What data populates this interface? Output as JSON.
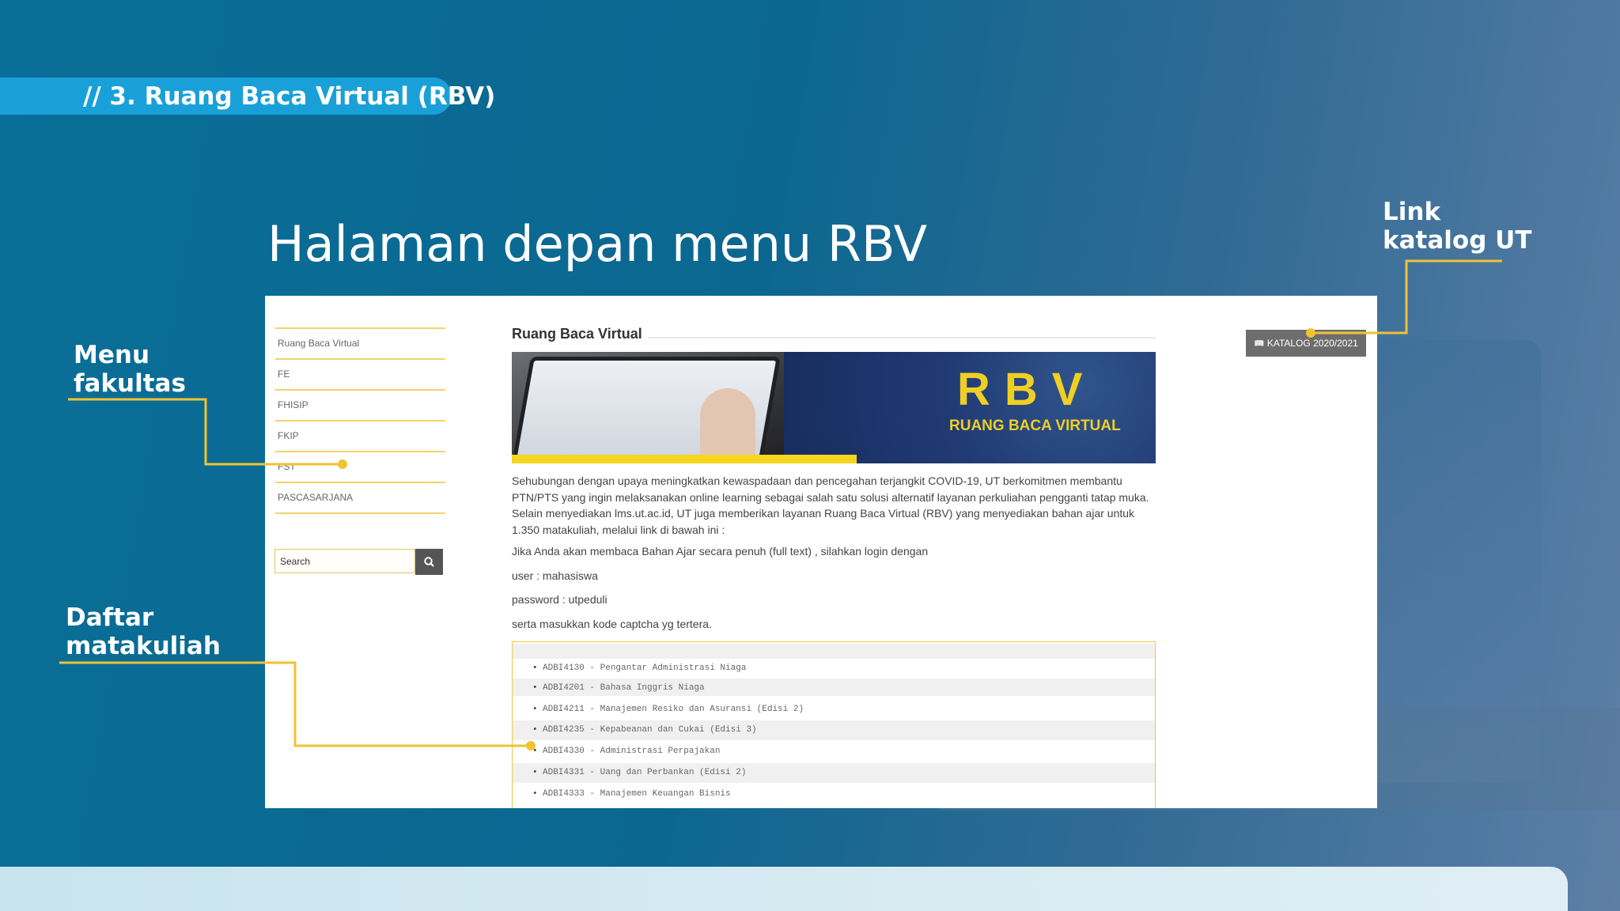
{
  "slide": {
    "section_label": "// 3. Ruang Baca Virtual (RBV)",
    "title": "Halaman depan menu RBV"
  },
  "callouts": {
    "menu_fakultas_line1": "Menu",
    "menu_fakultas_line2": "fakultas",
    "daftar_matakuliah_line1": "Daftar",
    "daftar_matakuliah_line2": "matakuliah",
    "link_katalog_line1": "Link",
    "link_katalog_line2": "katalog UT"
  },
  "colors": {
    "accent_yellow": "#f1c232",
    "pill_blue": "#1aa0d8"
  },
  "website": {
    "sidebar": {
      "items": [
        "Ruang Baca Virtual",
        "FE",
        "FHISIP",
        "FKIP",
        "FST",
        "PASCASARJANA"
      ]
    },
    "search": {
      "value": "Search"
    },
    "content": {
      "heading": "Ruang Baca Virtual",
      "banner_title": "RBV",
      "banner_subtitle": "RUANG BACA VIRTUAL",
      "intro": "Sehubungan dengan upaya meningkatkan kewaspadaan dan pencegahan terjangkit COVID-19, UT berkomitmen membantu PTN/PTS yang ingin melaksanakan online learning sebagai salah satu solusi alternatif layanan perkuliahan pengganti tatap muka. Selain menyediakan lms.ut.ac.id, UT juga memberikan layanan Ruang Baca Virtual (RBV) yang menyediakan bahan ajar untuk 1.350 matakuliah, melalui link di bawah ini :",
      "login_note": "Jika Anda akan membaca Bahan Ajar secara penuh (full text) , silahkan login dengan",
      "user_line": "user : mahasiswa",
      "password_line": "password : utpeduli",
      "captcha_note": "serta masukkan kode captcha yg tertera."
    },
    "courses": [
      "ADBI4130 - Pengantar Administrasi Niaga",
      "ADBI4201 - Bahasa Inggris Niaga",
      "ADBI4211 - Manajemen Resiko dan Asuransi (Edisi 2)",
      "ADBI4235 - Kepabeanan dan Cukai (Edisi 3)",
      "ADBI4330 - Administrasi Perpajakan",
      "ADBI4331 - Uang dan Perbankan (Edisi 2)",
      "ADBI4333 - Manajemen Keuangan Bisnis"
    ],
    "katalog_button": "KATALOG 2020/2021",
    "icons": {
      "search": "search-icon",
      "katalog": "book-icon"
    }
  }
}
